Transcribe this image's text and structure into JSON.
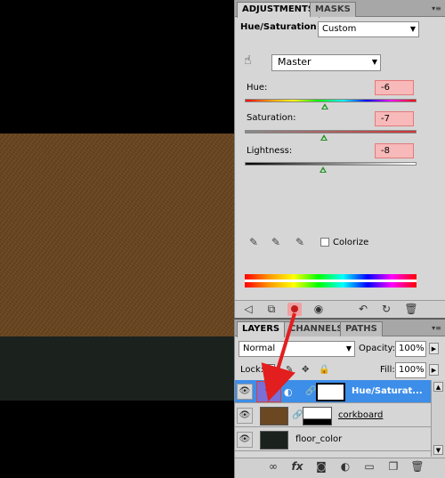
{
  "adjustments": {
    "tabs": [
      "ADJUSTMENTS",
      "MASKS"
    ],
    "title": "Hue/Saturation",
    "preset": "Custom",
    "channel": "Master",
    "hue": {
      "label": "Hue:",
      "value": "-6"
    },
    "saturation": {
      "label": "Saturation:",
      "value": "-7"
    },
    "lightness": {
      "label": "Lightness:",
      "value": "-8"
    },
    "colorize_label": "Colorize",
    "colorize_checked": false
  },
  "layers_panel": {
    "tabs": [
      "LAYERS",
      "CHANNELS",
      "PATHS"
    ],
    "blend_mode": "Normal",
    "opacity_label": "Opacity:",
    "opacity_value": "100%",
    "lock_label": "Lock:",
    "fill_label": "Fill:",
    "fill_value": "100%",
    "layers": [
      {
        "name": "Hue/Saturat...",
        "selected": true,
        "type": "adjustment"
      },
      {
        "name": "corkboard",
        "selected": false,
        "type": "image"
      },
      {
        "name": "floor_color",
        "selected": false,
        "type": "image"
      }
    ]
  },
  "colors": {
    "panel_bg": "#d6d6d6",
    "selection_blue": "#3d8ee9",
    "value_highlight": "#f7b9b9",
    "annotation_red": "#e21e1e",
    "cork_brown": "#6b4722",
    "floor_dark": "#1b221e"
  }
}
